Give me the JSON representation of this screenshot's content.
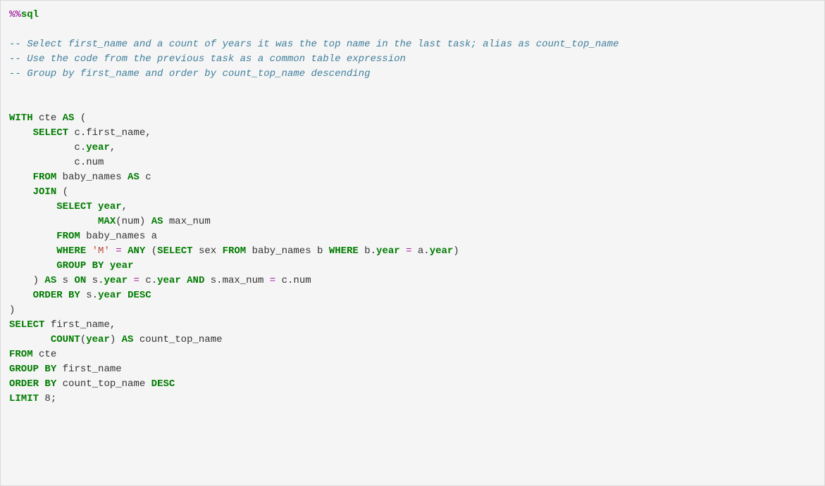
{
  "magic": {
    "op": "%%",
    "name": "sql"
  },
  "comments": {
    "c1": "-- Select first_name and a count of years it was the top name in the last task; alias as count_top_name",
    "c2": "-- Use the code from the previous task as a common table expression",
    "c3": "-- Group by first_name and order by count_top_name descending"
  },
  "kw": {
    "WITH": "WITH",
    "AS": "AS",
    "SELECT": "SELECT",
    "FROM": "FROM",
    "JOIN": "JOIN",
    "MAX": "MAX",
    "WHERE": "WHERE",
    "ANY": "ANY",
    "GROUP": "GROUP",
    "BY": "BY",
    "ON": "ON",
    "AND": "AND",
    "ORDER": "ORDER",
    "DESC": "DESC",
    "COUNT": "COUNT",
    "LIMIT": "LIMIT"
  },
  "id": {
    "cte": "cte",
    "c": "c",
    "first_name": "first_name",
    "year": "year",
    "num": "num",
    "baby_names": "baby_names",
    "max_num": "max_num",
    "a": "a",
    "sex": "sex",
    "b": "b",
    "s": "s",
    "count_top_name": "count_top_name"
  },
  "lit": {
    "M": "'M'",
    "eight": "8"
  },
  "punct": {
    "lparen": "(",
    "rparen": ")",
    "dot": ".",
    "comma": ",",
    "semicolon": ";",
    "eq": "=",
    "dash": "-"
  }
}
